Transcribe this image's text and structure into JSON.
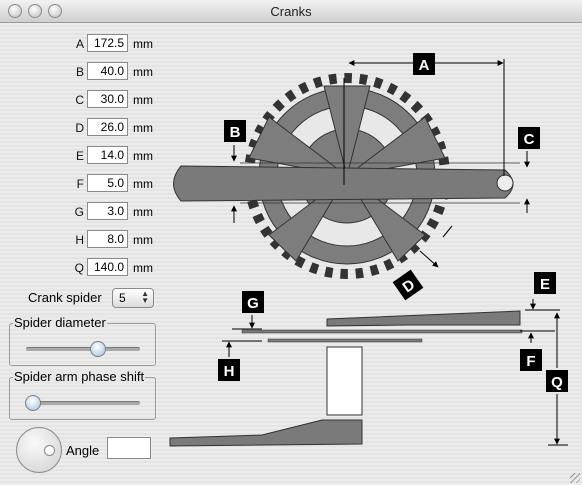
{
  "window": {
    "title": "Cranks"
  },
  "params": [
    {
      "key": "A",
      "value": "172.5",
      "unit": "mm"
    },
    {
      "key": "B",
      "value": "40.0",
      "unit": "mm"
    },
    {
      "key": "C",
      "value": "30.0",
      "unit": "mm"
    },
    {
      "key": "D",
      "value": "26.0",
      "unit": "mm"
    },
    {
      "key": "E",
      "value": "14.0",
      "unit": "mm"
    },
    {
      "key": "F",
      "value": "5.0",
      "unit": "mm"
    },
    {
      "key": "G",
      "value": "3.0",
      "unit": "mm"
    },
    {
      "key": "H",
      "value": "8.0",
      "unit": "mm"
    },
    {
      "key": "Q",
      "value": "140.0",
      "unit": "mm"
    }
  ],
  "crank_spider": {
    "label": "Crank spider",
    "value": "5"
  },
  "spider_diameter": {
    "label": "Spider diameter",
    "level": 0.62
  },
  "spider_phase": {
    "label": "Spider arm phase shift",
    "level": 0.05
  },
  "angle": {
    "label": "Angle",
    "value": ""
  },
  "diagram": {
    "markers": [
      "A",
      "B",
      "C",
      "D",
      "E",
      "F",
      "G",
      "H",
      "Q"
    ]
  },
  "icons": {
    "window_buttons": [
      "close-button-icon",
      "minimize-button-icon",
      "zoom-button-icon"
    ]
  }
}
